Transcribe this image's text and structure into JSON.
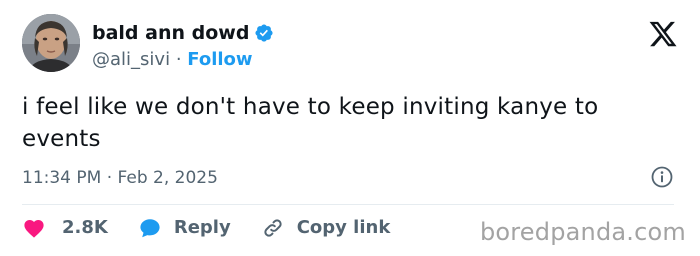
{
  "author": {
    "name": "bald ann dowd",
    "handle": "@ali_sivi",
    "separator": "·",
    "follow_label": "Follow",
    "verified_icon": "verified-badge-icon"
  },
  "tweet": {
    "text": "i feel like we don't have to keep inviting kanye to events",
    "time": "11:34 PM",
    "date_sep": "·",
    "date": "Feb 2, 2025"
  },
  "actions": {
    "like_count": "2.8K",
    "reply_label": "Reply",
    "copy_label": "Copy link"
  },
  "watermark": "boredpanda.com",
  "colors": {
    "accent": "#1d9bf0",
    "like": "#f91880",
    "text": "#0f1419",
    "secondary": "#536471"
  }
}
